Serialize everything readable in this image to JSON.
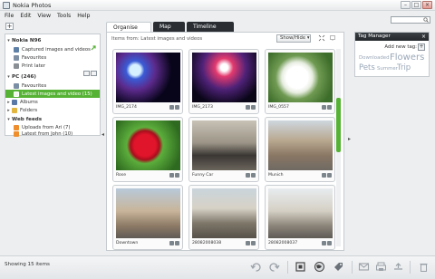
{
  "window": {
    "title": "Nokia Photos",
    "minimize": "–",
    "maximize": "□",
    "close": "×"
  },
  "menu": [
    "File",
    "Edit",
    "View",
    "Tools",
    "Help"
  ],
  "search": {
    "placeholder": ""
  },
  "sidebar": {
    "add_label": "+",
    "groups": [
      {
        "label": "Nokia N96",
        "items": [
          "Captured images and videos",
          "Favourites",
          "Print later"
        ]
      },
      {
        "label": "PC (246)",
        "items": [
          "Favourites",
          "Latest images and video (15)",
          "Albums",
          "Folders"
        ]
      },
      {
        "label": "Web feeds",
        "items": [
          "Uploads from Ari (7)",
          "Latest from John (10)"
        ]
      }
    ],
    "selected": "Latest images and video (15)"
  },
  "tabs": [
    "Organise",
    "Map",
    "Timeline"
  ],
  "main": {
    "header": "Items from: Latest images and videos",
    "showhide_label": "Show/Hide ▾",
    "thumbnails": [
      {
        "caption": "IMG_2174"
      },
      {
        "caption": "IMG_2173"
      },
      {
        "caption": "IMG_0557"
      },
      {
        "caption": "Rose"
      },
      {
        "caption": "Funny Car"
      },
      {
        "caption": "Munich"
      },
      {
        "caption": "Downtown"
      },
      {
        "caption": "28082008038"
      },
      {
        "caption": "28082008037"
      }
    ]
  },
  "tag_manager": {
    "title": "Tag Manager",
    "close": "×",
    "add_label": "Add new tag:",
    "add_btn": "+",
    "tags": [
      "Downloaded",
      "Flowers",
      "Pets",
      "Summer",
      "Trip"
    ]
  },
  "status": {
    "text": "Showing 15 items"
  },
  "colors": {
    "accent": "#56b234",
    "tab_dark": "#2a2e33"
  }
}
